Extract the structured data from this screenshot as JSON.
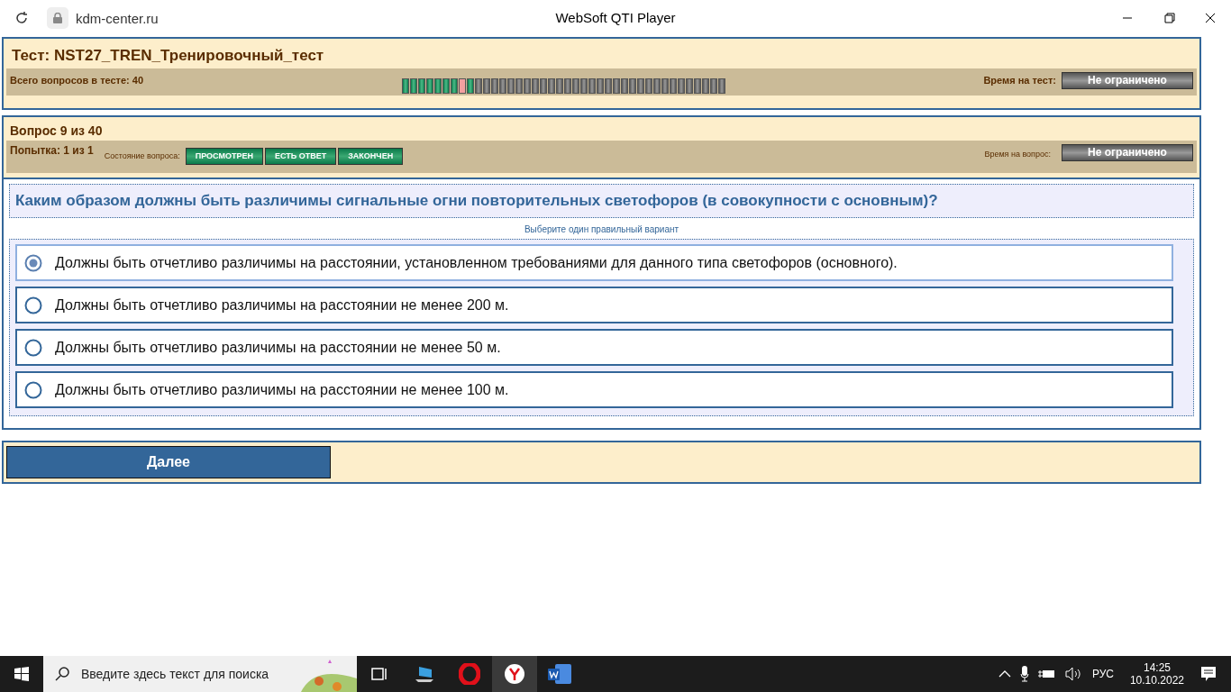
{
  "browser": {
    "address": "kdm-center.ru",
    "title": "WebSoft QTI Player"
  },
  "test": {
    "title": "Тест: NST27_TREN_Тренировочный_тест",
    "total_label": "Всего вопросов в тесте: 40",
    "time_label": "Время на тест:",
    "time_value": "Не ограничено",
    "progress": [
      {
        "answered": true,
        "skipped": false
      },
      {
        "answered": true,
        "skipped": false
      },
      {
        "answered": true,
        "skipped": false
      },
      {
        "answered": true,
        "skipped": false
      },
      {
        "answered": true,
        "skipped": false
      },
      {
        "answered": true,
        "skipped": false
      },
      {
        "answered": true,
        "skipped": false
      },
      {
        "answered": false,
        "skipped": true
      },
      {
        "answered": true,
        "skipped": false
      },
      {
        "answered": false,
        "skipped": false
      },
      {
        "answered": false,
        "skipped": false
      },
      {
        "answered": false,
        "skipped": false
      },
      {
        "answered": false,
        "skipped": false
      },
      {
        "answered": false,
        "skipped": false
      },
      {
        "answered": false,
        "skipped": false
      },
      {
        "answered": false,
        "skipped": false
      },
      {
        "answered": false,
        "skipped": false
      },
      {
        "answered": false,
        "skipped": false
      },
      {
        "answered": false,
        "skipped": false
      },
      {
        "answered": false,
        "skipped": false
      },
      {
        "answered": false,
        "skipped": false
      },
      {
        "answered": false,
        "skipped": false
      },
      {
        "answered": false,
        "skipped": false
      },
      {
        "answered": false,
        "skipped": false
      },
      {
        "answered": false,
        "skipped": false
      },
      {
        "answered": false,
        "skipped": false
      },
      {
        "answered": false,
        "skipped": false
      },
      {
        "answered": false,
        "skipped": false
      },
      {
        "answered": false,
        "skipped": false
      },
      {
        "answered": false,
        "skipped": false
      },
      {
        "answered": false,
        "skipped": false
      },
      {
        "answered": false,
        "skipped": false
      },
      {
        "answered": false,
        "skipped": false
      },
      {
        "answered": false,
        "skipped": false
      },
      {
        "answered": false,
        "skipped": false
      },
      {
        "answered": false,
        "skipped": false
      },
      {
        "answered": false,
        "skipped": false
      },
      {
        "answered": false,
        "skipped": false
      },
      {
        "answered": false,
        "skipped": false
      },
      {
        "answered": false,
        "skipped": false
      }
    ]
  },
  "question": {
    "number_label": "Вопрос 9 из 40",
    "attempt_label": "Попытка: 1 из 1",
    "state_label": "Состояние вопроса:",
    "states": [
      {
        "label": "ПРОСМОТРЕН",
        "on": true
      },
      {
        "label": "ЕСТЬ ОТВЕТ",
        "on": true
      },
      {
        "label": "ЗАКОНЧЕН",
        "on": true
      }
    ],
    "time_label": "Время на вопрос:",
    "time_value": "Не ограничено",
    "text": "Каким образом должны быть различимы сигнальные огни повторительных светофоров (в совокупности с основным)?",
    "hint": "Выберите один правильный вариант",
    "options": [
      {
        "label": "Должны быть отчетливо различимы на расстоянии, установленном требованиями для данного типа светофоров (основного).",
        "selected": true
      },
      {
        "label": "Должны быть отчетливо различимы на расстоянии не менее 200 м.",
        "selected": false
      },
      {
        "label": "Должны быть отчетливо различимы на расстоянии не менее 50 м.",
        "selected": false
      },
      {
        "label": "Должны быть отчетливо различимы на расстоянии не менее 100 м.",
        "selected": false
      }
    ]
  },
  "next_button": "Далее",
  "taskbar": {
    "search_placeholder": "Введите здесь текст для поиска",
    "language": "РУС",
    "time": "14:25",
    "date": "10.10.2022"
  }
}
